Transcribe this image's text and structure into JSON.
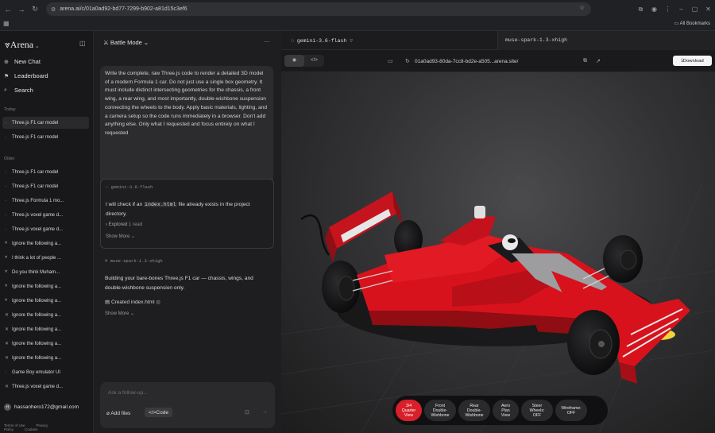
{
  "browser": {
    "url": "arena.ai/c/01a0ad92-bd77-7299-b902-a81d15c3ef6",
    "all_bookmarks": "All Bookmarks"
  },
  "sidebar": {
    "logo": "Arena",
    "new_chat": "New Chat",
    "leaderboard": "Leaderboard",
    "search": "Search",
    "today_label": "Today",
    "today": [
      "Three.js F1 car model",
      "Three.js F1 car model"
    ],
    "older_label": "Older",
    "older": [
      "Three.js F1 car model",
      "Three.js F1 car model",
      "Three.js Formula 1 mo...",
      "Three.js voxel game d...",
      "Three.js voxel game d...",
      "Ignore the following a...",
      "I think a lot of people ...",
      "Do you think Muham...",
      "Ignore the following a...",
      "Ignore the following a...",
      "Ignore the following a...",
      "Ignore the following a...",
      "Ignore the following a...",
      "Ignore the following a...",
      "Game Boy emulator UI",
      "Three.js voxel game d..."
    ],
    "user_email": "hassanhero172@gmail.com",
    "footer": [
      "Terms of Use",
      "Privacy Policy",
      "Cookies"
    ]
  },
  "chat": {
    "mode": "Battle Mode",
    "prompt": "Write the complete, raw Three.js code to render a detailed 3D model of a modern Formula 1 car. Do not just use a single box geometry. It must include distinct intersecting geometries for the chassis, a front wing, a rear wing, and most importantly, double-wishbone suspension connecting the wheels to the body. Apply basic materials, lighting, and a camera setup so the code runs immediately in a browser. Don't add anything else. Only what I requested and focus entirely on what I requested",
    "response1": {
      "model": "gemini-3.6-flash",
      "text_before": "I will check if an",
      "code": "index.html",
      "text_after": "file already exists in the project directory.",
      "explored": "Explored",
      "explored_count": "1 read",
      "show_more": "Show More"
    },
    "response2": {
      "model": "muse-spark-1.3-xhigh",
      "text": "Building your bare-bones Three.js F1 car — chassis, wings, and double-wishbone suspension only.",
      "created": "Created index.html",
      "show_more": "Show More"
    },
    "input_placeholder": "Ask a follow-up...",
    "add_files": "Add files",
    "code_label": "Code"
  },
  "preview": {
    "tab_left": "gemini-3.6-flash",
    "tab_right": "muse-spark-1.3-xhigh",
    "url": "01a0ad93-80da-7cc8-bd2e-a505...arena.site/",
    "download": "Download",
    "view_buttons": [
      {
        "label": "3/4\nQuarter\nView",
        "active": true
      },
      {
        "label": "Front\nDouble-\nWishbone",
        "active": false
      },
      {
        "label": "Rear\nDouble-\nWishbone",
        "active": false
      },
      {
        "label": "Aero\nPlan\nView",
        "active": false
      },
      {
        "label": "Steer\nWheels:\nOFF",
        "active": false
      },
      {
        "label": "Wireframe:\nOFF",
        "active": false
      }
    ]
  },
  "colors": {
    "car_red": "#d8121c",
    "active_button": "#d91f2a"
  }
}
